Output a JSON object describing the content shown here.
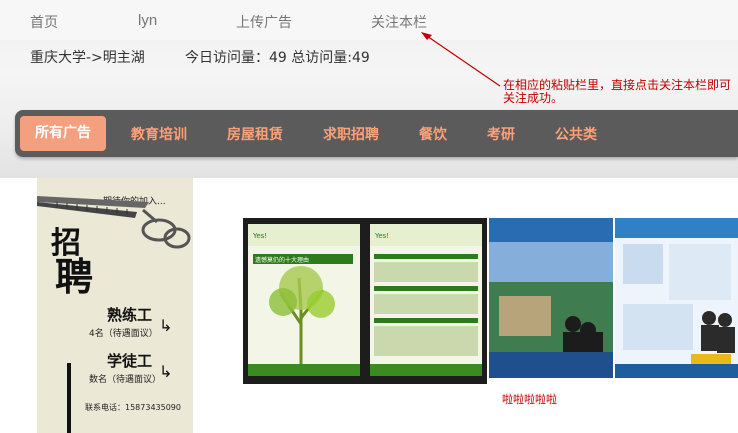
{
  "topnav": {
    "home": "首页",
    "user": "lyn",
    "upload": "上传广告",
    "follow": "关注本栏"
  },
  "info": {
    "location": "重庆大学->明主湖",
    "stats": "今日访问量：49 总访问量:49"
  },
  "callout": {
    "text": "在相应的粘贴栏里，直接点击关注本栏即可关注成功。",
    "color": "#c00000"
  },
  "categories": {
    "active": "所有广告",
    "items": [
      "教育培训",
      "房屋租赁",
      "求职招聘",
      "餐饮",
      "考研",
      "公共类"
    ]
  },
  "poster": {
    "tagline": "期待你的加入...",
    "title_top": "招",
    "title_bottom": "聘",
    "job1": "熟练工",
    "job1_sub": "4名（待遇面议）",
    "job2": "学徒工",
    "job2_sub": "数名（待遇面议）",
    "phone": "联系电话：15873435090"
  },
  "flyers": {
    "caption": "啦啦啦啦啦",
    "heading": "遗憾莫仍的十大理由"
  },
  "colors": {
    "accent": "#f4a07e",
    "category_text": "#ffa078",
    "category_bar": "#5b5b5b"
  }
}
